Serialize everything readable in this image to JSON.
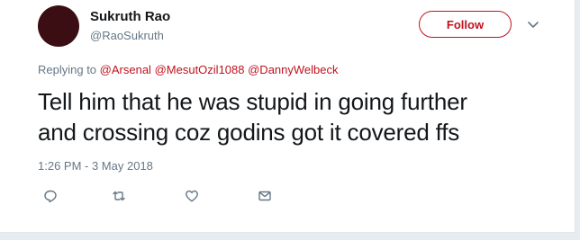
{
  "user": {
    "name": "Sukruth Rao",
    "handle": "@RaoSukruth"
  },
  "follow_label": "Follow",
  "replying": {
    "prefix": "Replying to",
    "mentions": [
      "@Arsenal",
      "@MesutOzil1088",
      "@DannyWelbeck"
    ]
  },
  "tweet": {
    "line1": "Tell him that he was stupid in going further",
    "line2": "and crossing coz godins got it covered ffs",
    "timestamp": "1:26 PM - 3 May 2018"
  },
  "actions": [
    "reply-icon",
    "retweet-icon",
    "like-icon",
    "message-icon"
  ],
  "colors": {
    "accent": "#c0121f",
    "secondary_text": "#657786",
    "icon": "#657786",
    "background": "#e6ecf0"
  }
}
